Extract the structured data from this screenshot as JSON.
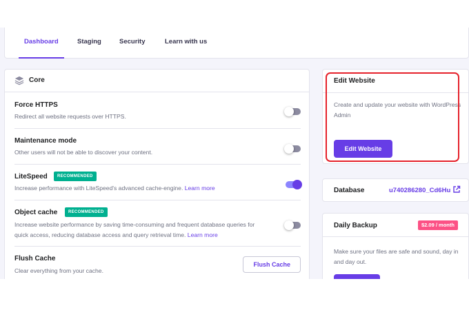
{
  "tabs": [
    {
      "label": "Dashboard",
      "active": true
    },
    {
      "label": "Staging",
      "active": false
    },
    {
      "label": "Security",
      "active": false
    },
    {
      "label": "Learn with us",
      "active": false
    }
  ],
  "core": {
    "title": "Core",
    "icon": "layers-icon",
    "settings": [
      {
        "title": "Force HTTPS",
        "description": "Redirect all website requests over HTTPS.",
        "toggle_on": false
      },
      {
        "title": "Maintenance mode",
        "description": "Other users will not be able to discover your content.",
        "toggle_on": false
      },
      {
        "title": "LiteSpeed",
        "badge": "RECOMMENDED",
        "description": "Increase performance with LiteSpeed's advanced cache-engine.",
        "link": "Learn more",
        "toggle_on": true
      },
      {
        "title": "Object cache",
        "badge": "RECOMMENDED",
        "description_line1": "Increase website performance by saving time-consuming and frequent database queries for",
        "description_line2": "quick access, reducing database access and query retrieval time.",
        "link": "Learn more",
        "toggle_on": false
      },
      {
        "title": "Flush Cache",
        "description": "Clear everything from your cache.",
        "button": "Flush Cache"
      }
    ]
  },
  "edit_website": {
    "title": "Edit Website",
    "description": "Create and update your website with WordPress Admin",
    "button": "Edit Website"
  },
  "database": {
    "label": "Database",
    "value": "u740286280_Cd6Hu",
    "icon": "external-link-icon"
  },
  "daily_backup": {
    "title": "Daily Backup",
    "price": "$2.09 / month",
    "description": "Make sure your files are safe and sound, day in and day out."
  },
  "colors": {
    "accent": "#673de6",
    "badge_green": "#00b090",
    "price_pink": "#fc5185",
    "highlight_red": "#e5202a"
  }
}
